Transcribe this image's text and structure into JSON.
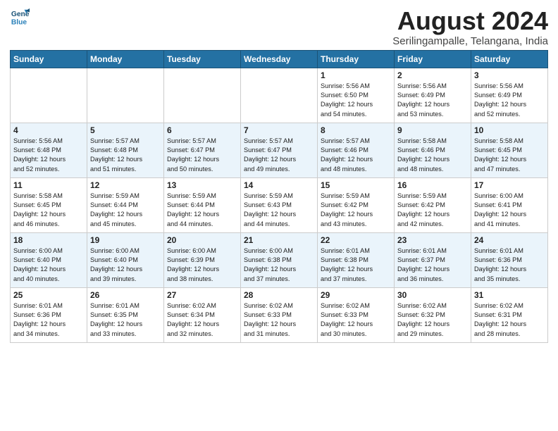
{
  "header": {
    "logo_line1": "General",
    "logo_line2": "Blue",
    "month_year": "August 2024",
    "location": "Serilingampalle, Telangana, India"
  },
  "weekdays": [
    "Sunday",
    "Monday",
    "Tuesday",
    "Wednesday",
    "Thursday",
    "Friday",
    "Saturday"
  ],
  "weeks": [
    [
      {
        "day": "",
        "text": ""
      },
      {
        "day": "",
        "text": ""
      },
      {
        "day": "",
        "text": ""
      },
      {
        "day": "",
        "text": ""
      },
      {
        "day": "1",
        "text": "Sunrise: 5:56 AM\nSunset: 6:50 PM\nDaylight: 12 hours\nand 54 minutes."
      },
      {
        "day": "2",
        "text": "Sunrise: 5:56 AM\nSunset: 6:49 PM\nDaylight: 12 hours\nand 53 minutes."
      },
      {
        "day": "3",
        "text": "Sunrise: 5:56 AM\nSunset: 6:49 PM\nDaylight: 12 hours\nand 52 minutes."
      }
    ],
    [
      {
        "day": "4",
        "text": "Sunrise: 5:56 AM\nSunset: 6:48 PM\nDaylight: 12 hours\nand 52 minutes."
      },
      {
        "day": "5",
        "text": "Sunrise: 5:57 AM\nSunset: 6:48 PM\nDaylight: 12 hours\nand 51 minutes."
      },
      {
        "day": "6",
        "text": "Sunrise: 5:57 AM\nSunset: 6:47 PM\nDaylight: 12 hours\nand 50 minutes."
      },
      {
        "day": "7",
        "text": "Sunrise: 5:57 AM\nSunset: 6:47 PM\nDaylight: 12 hours\nand 49 minutes."
      },
      {
        "day": "8",
        "text": "Sunrise: 5:57 AM\nSunset: 6:46 PM\nDaylight: 12 hours\nand 48 minutes."
      },
      {
        "day": "9",
        "text": "Sunrise: 5:58 AM\nSunset: 6:46 PM\nDaylight: 12 hours\nand 48 minutes."
      },
      {
        "day": "10",
        "text": "Sunrise: 5:58 AM\nSunset: 6:45 PM\nDaylight: 12 hours\nand 47 minutes."
      }
    ],
    [
      {
        "day": "11",
        "text": "Sunrise: 5:58 AM\nSunset: 6:45 PM\nDaylight: 12 hours\nand 46 minutes."
      },
      {
        "day": "12",
        "text": "Sunrise: 5:59 AM\nSunset: 6:44 PM\nDaylight: 12 hours\nand 45 minutes."
      },
      {
        "day": "13",
        "text": "Sunrise: 5:59 AM\nSunset: 6:44 PM\nDaylight: 12 hours\nand 44 minutes."
      },
      {
        "day": "14",
        "text": "Sunrise: 5:59 AM\nSunset: 6:43 PM\nDaylight: 12 hours\nand 44 minutes."
      },
      {
        "day": "15",
        "text": "Sunrise: 5:59 AM\nSunset: 6:42 PM\nDaylight: 12 hours\nand 43 minutes."
      },
      {
        "day": "16",
        "text": "Sunrise: 5:59 AM\nSunset: 6:42 PM\nDaylight: 12 hours\nand 42 minutes."
      },
      {
        "day": "17",
        "text": "Sunrise: 6:00 AM\nSunset: 6:41 PM\nDaylight: 12 hours\nand 41 minutes."
      }
    ],
    [
      {
        "day": "18",
        "text": "Sunrise: 6:00 AM\nSunset: 6:40 PM\nDaylight: 12 hours\nand 40 minutes."
      },
      {
        "day": "19",
        "text": "Sunrise: 6:00 AM\nSunset: 6:40 PM\nDaylight: 12 hours\nand 39 minutes."
      },
      {
        "day": "20",
        "text": "Sunrise: 6:00 AM\nSunset: 6:39 PM\nDaylight: 12 hours\nand 38 minutes."
      },
      {
        "day": "21",
        "text": "Sunrise: 6:00 AM\nSunset: 6:38 PM\nDaylight: 12 hours\nand 37 minutes."
      },
      {
        "day": "22",
        "text": "Sunrise: 6:01 AM\nSunset: 6:38 PM\nDaylight: 12 hours\nand 37 minutes."
      },
      {
        "day": "23",
        "text": "Sunrise: 6:01 AM\nSunset: 6:37 PM\nDaylight: 12 hours\nand 36 minutes."
      },
      {
        "day": "24",
        "text": "Sunrise: 6:01 AM\nSunset: 6:36 PM\nDaylight: 12 hours\nand 35 minutes."
      }
    ],
    [
      {
        "day": "25",
        "text": "Sunrise: 6:01 AM\nSunset: 6:36 PM\nDaylight: 12 hours\nand 34 minutes."
      },
      {
        "day": "26",
        "text": "Sunrise: 6:01 AM\nSunset: 6:35 PM\nDaylight: 12 hours\nand 33 minutes."
      },
      {
        "day": "27",
        "text": "Sunrise: 6:02 AM\nSunset: 6:34 PM\nDaylight: 12 hours\nand 32 minutes."
      },
      {
        "day": "28",
        "text": "Sunrise: 6:02 AM\nSunset: 6:33 PM\nDaylight: 12 hours\nand 31 minutes."
      },
      {
        "day": "29",
        "text": "Sunrise: 6:02 AM\nSunset: 6:33 PM\nDaylight: 12 hours\nand 30 minutes."
      },
      {
        "day": "30",
        "text": "Sunrise: 6:02 AM\nSunset: 6:32 PM\nDaylight: 12 hours\nand 29 minutes."
      },
      {
        "day": "31",
        "text": "Sunrise: 6:02 AM\nSunset: 6:31 PM\nDaylight: 12 hours\nand 28 minutes."
      }
    ]
  ]
}
